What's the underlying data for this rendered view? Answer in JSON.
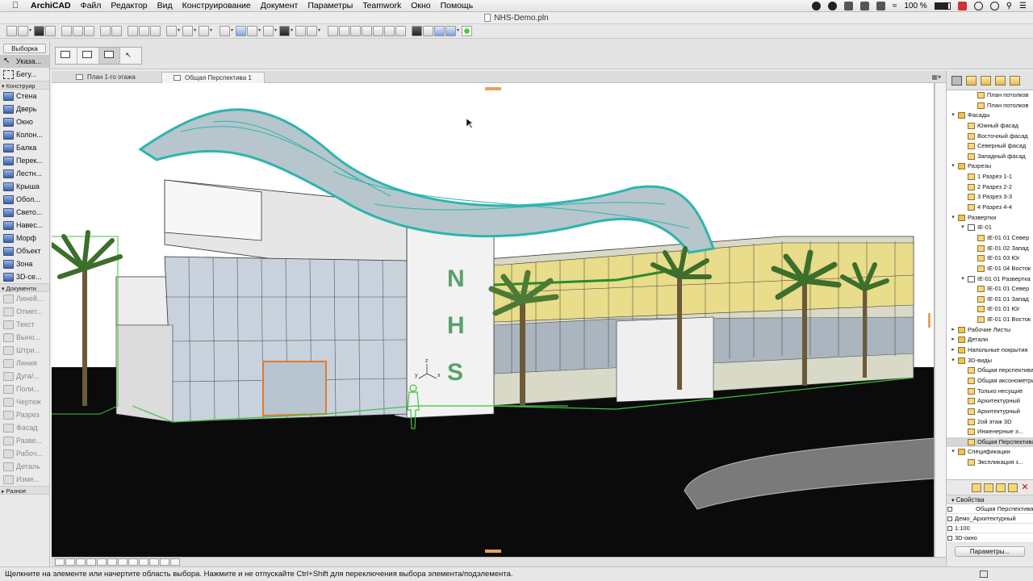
{
  "menubar": {
    "app": "ArchiCAD",
    "items": [
      "Файл",
      "Редактор",
      "Вид",
      "Конструирование",
      "Документ",
      "Параметры",
      "Teamwork",
      "Окно",
      "Помощь"
    ],
    "battery": "100 %",
    "battery_icon": "battery-icon",
    "wifi_icon": "wifi-icon"
  },
  "window": {
    "title": "NHS-Demo.pln"
  },
  "toolbox": {
    "header": "Выборка",
    "select_tools": [
      {
        "label": "Указа...",
        "icon": "arrow-pointer-icon"
      },
      {
        "label": "Бегу...",
        "icon": "marquee-icon"
      }
    ],
    "design_section": "Конструир",
    "design_tools": [
      {
        "label": "Стена",
        "icon": "wall-icon"
      },
      {
        "label": "Дверь",
        "icon": "door-icon"
      },
      {
        "label": "Окно",
        "icon": "window-icon"
      },
      {
        "label": "Колон...",
        "icon": "column-icon"
      },
      {
        "label": "Балка",
        "icon": "beam-icon"
      },
      {
        "label": "Перек...",
        "icon": "slab-icon"
      },
      {
        "label": "Лестн...",
        "icon": "stair-icon"
      },
      {
        "label": "Крыша",
        "icon": "roof-icon"
      },
      {
        "label": "Обол...",
        "icon": "shell-icon"
      },
      {
        "label": "Свето...",
        "icon": "skylight-icon"
      },
      {
        "label": "Навес...",
        "icon": "curtain-wall-icon"
      },
      {
        "label": "Морф",
        "icon": "morph-icon"
      },
      {
        "label": "Объект",
        "icon": "object-icon"
      },
      {
        "label": "Зона",
        "icon": "zone-icon"
      },
      {
        "label": "3D-се...",
        "icon": "mesh-icon"
      }
    ],
    "document_section": "Документи",
    "document_tools": [
      {
        "label": "Линей...",
        "icon": "dimension-icon"
      },
      {
        "label": "Отмет...",
        "icon": "level-dimension-icon"
      },
      {
        "label": "Текст",
        "icon": "text-icon"
      },
      {
        "label": "Выно...",
        "icon": "label-icon"
      },
      {
        "label": "Штри...",
        "icon": "fill-icon"
      },
      {
        "label": "Линия",
        "icon": "line-icon"
      },
      {
        "label": "Дуга/...",
        "icon": "arc-icon"
      },
      {
        "label": "Поли...",
        "icon": "polyline-icon"
      },
      {
        "label": "Чертеж",
        "icon": "drawing-icon"
      },
      {
        "label": "Разрез",
        "icon": "section-icon"
      },
      {
        "label": "Фасад",
        "icon": "elevation-icon"
      },
      {
        "label": "Разве...",
        "icon": "interior-elevation-icon"
      },
      {
        "label": "Рабоч...",
        "icon": "worksheet-icon"
      },
      {
        "label": "Деталь",
        "icon": "detail-icon"
      },
      {
        "label": "Изме...",
        "icon": "change-icon"
      }
    ],
    "other_section": "Разное"
  },
  "tabs": [
    {
      "label": "План 1-го этажа",
      "active": false
    },
    {
      "label": "Общая Перспектива 1",
      "active": true
    }
  ],
  "viewport": {
    "building_letters": [
      "N",
      "H",
      "S"
    ],
    "axis_labels": {
      "x": "x",
      "y": "y",
      "z": "z"
    }
  },
  "navigator": {
    "tree": [
      {
        "label": "План потолков",
        "level": 3,
        "type": "view"
      },
      {
        "label": "План потолков",
        "level": 3,
        "type": "view"
      },
      {
        "label": "Фасады",
        "level": 1,
        "type": "folder",
        "expanded": true
      },
      {
        "label": "Южный фасад",
        "level": 2,
        "type": "view"
      },
      {
        "label": "Восточный фасад",
        "level": 2,
        "type": "view"
      },
      {
        "label": "Северный фасад",
        "level": 2,
        "type": "view"
      },
      {
        "label": "Западный фасад",
        "level": 2,
        "type": "view"
      },
      {
        "label": "Разрезы",
        "level": 1,
        "type": "folder",
        "expanded": true
      },
      {
        "label": "1 Разрез 1-1",
        "level": 2,
        "type": "view"
      },
      {
        "label": "2 Разрез 2-2",
        "level": 2,
        "type": "view"
      },
      {
        "label": "3 Разрез 3-3",
        "level": 2,
        "type": "view"
      },
      {
        "label": "4 Разрез 4-4",
        "level": 2,
        "type": "view"
      },
      {
        "label": "Развертки",
        "level": 1,
        "type": "folder",
        "expanded": true
      },
      {
        "label": "IE-01",
        "level": 2,
        "type": "group",
        "expanded": true
      },
      {
        "label": "IE-01 01 Север",
        "level": 3,
        "type": "view"
      },
      {
        "label": "IE-01 02 Запад",
        "level": 3,
        "type": "view"
      },
      {
        "label": "IE-01 03 Юг",
        "level": 3,
        "type": "view"
      },
      {
        "label": "IE-01 04 Восток",
        "level": 3,
        "type": "view"
      },
      {
        "label": "IE-01 01 Развертка",
        "level": 2,
        "type": "group",
        "expanded": true
      },
      {
        "label": "IE-01 01 Север",
        "level": 3,
        "type": "view"
      },
      {
        "label": "IE-01 01 Запад",
        "level": 3,
        "type": "view"
      },
      {
        "label": "IE-01 01 Юг",
        "level": 3,
        "type": "view"
      },
      {
        "label": "IE-01 01 Восток",
        "level": 3,
        "type": "view"
      },
      {
        "label": "Рабочие Листы",
        "level": 1,
        "type": "folder",
        "expanded": false
      },
      {
        "label": "Детали",
        "level": 1,
        "type": "folder",
        "expanded": false
      },
      {
        "label": "Напольные покрытия",
        "level": 1,
        "type": "folder",
        "expanded": false
      },
      {
        "label": "3D-виды",
        "level": 1,
        "type": "folder",
        "expanded": true
      },
      {
        "label": "Общая перспектива",
        "level": 2,
        "type": "view"
      },
      {
        "label": "Общая аксонометрия",
        "level": 2,
        "type": "view"
      },
      {
        "label": "Только несущие",
        "level": 2,
        "type": "view"
      },
      {
        "label": "Архитектурный",
        "level": 2,
        "type": "view"
      },
      {
        "label": "Архитектурный",
        "level": 2,
        "type": "view"
      },
      {
        "label": "2ой этаж 3D",
        "level": 2,
        "type": "view"
      },
      {
        "label": "Инженерные э...",
        "level": 2,
        "type": "view"
      },
      {
        "label": "Общая Перспектива 1",
        "level": 2,
        "type": "view",
        "selected": true
      },
      {
        "label": "Спецификации",
        "level": 1,
        "type": "folder",
        "expanded": true
      },
      {
        "label": "Экспликация з...",
        "level": 2,
        "type": "view"
      }
    ]
  },
  "properties": {
    "header": "Свойства",
    "name": "Общая Перспектива 1",
    "layer_combo": "Демо_Архитектурный",
    "scale": "1:100",
    "view_type": "3D-окно",
    "button": "Параметры..."
  },
  "status": {
    "text": "Щелкните на элементе или начертите область выбора. Нажмите и не отпускайте Ctrl+Shift для переключения выбора элемента/подэлемента."
  },
  "colors": {
    "ground": "#0b0b0b",
    "canopy": "#2cb5ae",
    "facade_yellow": "#e9dc8a",
    "outline_green": "#3cc43c",
    "letters": "#58a26a"
  }
}
